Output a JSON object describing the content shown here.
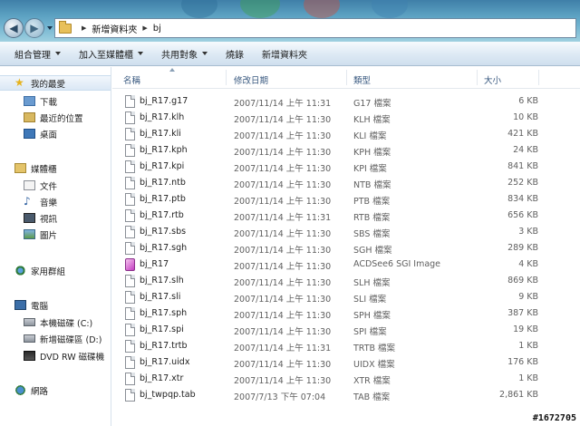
{
  "address": {
    "breadcrumbs": [
      "新增資料夾",
      "bj"
    ]
  },
  "toolbar": {
    "items": [
      {
        "label": "組合管理",
        "dropdown": true
      },
      {
        "label": "加入至媒體櫃",
        "dropdown": true
      },
      {
        "label": "共用對象",
        "dropdown": true
      },
      {
        "label": "燒錄",
        "dropdown": false
      },
      {
        "label": "新增資料夾",
        "dropdown": false
      }
    ]
  },
  "sidebar": {
    "favorites": {
      "label": "我的最愛",
      "icon": "star-icon"
    },
    "favorites_items": [
      {
        "label": "下載",
        "icon": "downloads-folder-icon"
      },
      {
        "label": "最近的位置",
        "icon": "recent-places-icon"
      },
      {
        "label": "桌面",
        "icon": "desktop-icon"
      }
    ],
    "libraries": {
      "label": "媒體櫃",
      "icon": "libraries-icon"
    },
    "libraries_items": [
      {
        "label": "文件",
        "icon": "documents-icon"
      },
      {
        "label": "音樂",
        "icon": "music-icon"
      },
      {
        "label": "視訊",
        "icon": "video-icon"
      },
      {
        "label": "圖片",
        "icon": "pictures-icon"
      }
    ],
    "homegroup": {
      "label": "家用群組",
      "icon": "homegroup-icon"
    },
    "computer": {
      "label": "電腦",
      "icon": "computer-icon"
    },
    "computer_items": [
      {
        "label": "本機磁碟 (C:)",
        "icon": "hard-disk-icon"
      },
      {
        "label": "新增磁碟區 (D:)",
        "icon": "hard-disk-icon"
      },
      {
        "label": "DVD RW 磁碟機",
        "icon": "dvd-drive-icon"
      }
    ],
    "network": {
      "label": "網路",
      "icon": "network-icon"
    }
  },
  "columns": {
    "name": "名稱",
    "date": "修改日期",
    "type": "類型",
    "size": "大小"
  },
  "files": [
    {
      "name": "bj_R17.g17",
      "date": "2007/11/14 上午 11:31",
      "type": "G17 檔案",
      "size": "6 KB"
    },
    {
      "name": "bj_R17.klh",
      "date": "2007/11/14 上午 11:30",
      "type": "KLH 檔案",
      "size": "10 KB"
    },
    {
      "name": "bj_R17.kli",
      "date": "2007/11/14 上午 11:30",
      "type": "KLI 檔案",
      "size": "421 KB"
    },
    {
      "name": "bj_R17.kph",
      "date": "2007/11/14 上午 11:30",
      "type": "KPH 檔案",
      "size": "24 KB"
    },
    {
      "name": "bj_R17.kpi",
      "date": "2007/11/14 上午 11:30",
      "type": "KPI 檔案",
      "size": "841 KB"
    },
    {
      "name": "bj_R17.ntb",
      "date": "2007/11/14 上午 11:30",
      "type": "NTB 檔案",
      "size": "252 KB"
    },
    {
      "name": "bj_R17.ptb",
      "date": "2007/11/14 上午 11:30",
      "type": "PTB 檔案",
      "size": "834 KB"
    },
    {
      "name": "bj_R17.rtb",
      "date": "2007/11/14 上午 11:31",
      "type": "RTB 檔案",
      "size": "656 KB"
    },
    {
      "name": "bj_R17.sbs",
      "date": "2007/11/14 上午 11:30",
      "type": "SBS 檔案",
      "size": "3 KB"
    },
    {
      "name": "bj_R17.sgh",
      "date": "2007/11/14 上午 11:30",
      "type": "SGH 檔案",
      "size": "289 KB"
    },
    {
      "name": "bj_R17",
      "date": "2007/11/14 上午 11:30",
      "type": "ACDSee6 SGI Image",
      "size": "4 KB",
      "icon": "acdsee-image-icon"
    },
    {
      "name": "bj_R17.slh",
      "date": "2007/11/14 上午 11:30",
      "type": "SLH 檔案",
      "size": "869 KB"
    },
    {
      "name": "bj_R17.sli",
      "date": "2007/11/14 上午 11:30",
      "type": "SLI 檔案",
      "size": "9 KB"
    },
    {
      "name": "bj_R17.sph",
      "date": "2007/11/14 上午 11:30",
      "type": "SPH 檔案",
      "size": "387 KB"
    },
    {
      "name": "bj_R17.spi",
      "date": "2007/11/14 上午 11:30",
      "type": "SPI 檔案",
      "size": "19 KB"
    },
    {
      "name": "bj_R17.trtb",
      "date": "2007/11/14 上午 11:31",
      "type": "TRTB 檔案",
      "size": "1 KB"
    },
    {
      "name": "bj_R17.uidx",
      "date": "2007/11/14 上午 11:30",
      "type": "UIDX 檔案",
      "size": "176 KB"
    },
    {
      "name": "bj_R17.xtr",
      "date": "2007/11/14 上午 11:30",
      "type": "XTR 檔案",
      "size": "1 KB"
    },
    {
      "name": "bj_twpqp.tab",
      "date": "2007/7/13 下午 07:04",
      "type": "TAB 檔案",
      "size": "2,861 KB"
    }
  ],
  "watermark": "#1672705"
}
